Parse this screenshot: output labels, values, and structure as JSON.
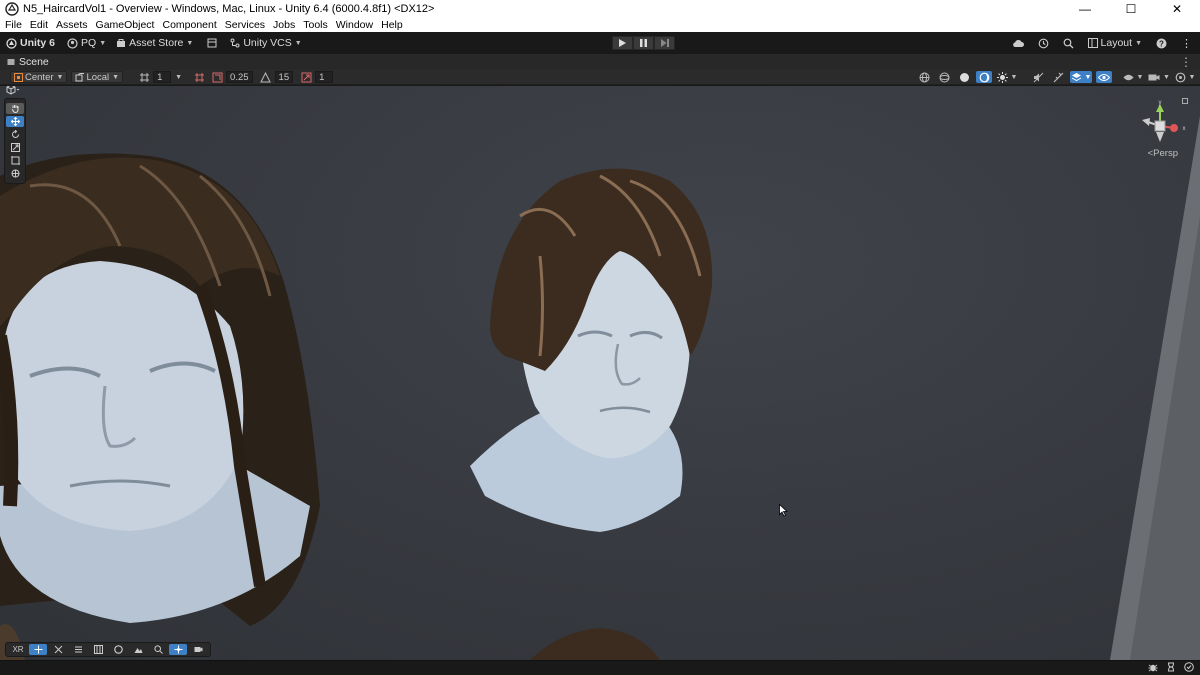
{
  "window": {
    "title": "N5_HaircardVol1 - Overview - Windows, Mac, Linux - Unity 6.4 (6000.4.8f1) <DX12>",
    "minimize": "—",
    "maximize": "☐",
    "close": "✕"
  },
  "menu": [
    "File",
    "Edit",
    "Assets",
    "GameObject",
    "Component",
    "Services",
    "Jobs",
    "Tools",
    "Window",
    "Help"
  ],
  "toolbar": {
    "unity_label": "Unity 6",
    "account_label": "PQ",
    "asset_store_label": "Asset Store",
    "vcs_label": "Unity VCS",
    "layout_label": "Layout"
  },
  "tab": {
    "scene_label": "Scene"
  },
  "scene_toolbar": {
    "pivot_label": "Center",
    "space_label": "Local",
    "grid_value": "1",
    "snap_increment": "0.25",
    "rotate_snap": "15",
    "scale_snap": "1"
  },
  "viewport": {
    "persp_label": "<Persp",
    "gizmo_y": "y",
    "gizmo_x": "x"
  },
  "bottom_overlay": {
    "xr_label": "XR"
  },
  "colors": {
    "accent": "#3d80c6",
    "background": "#191919",
    "viewport": "#383b41"
  }
}
